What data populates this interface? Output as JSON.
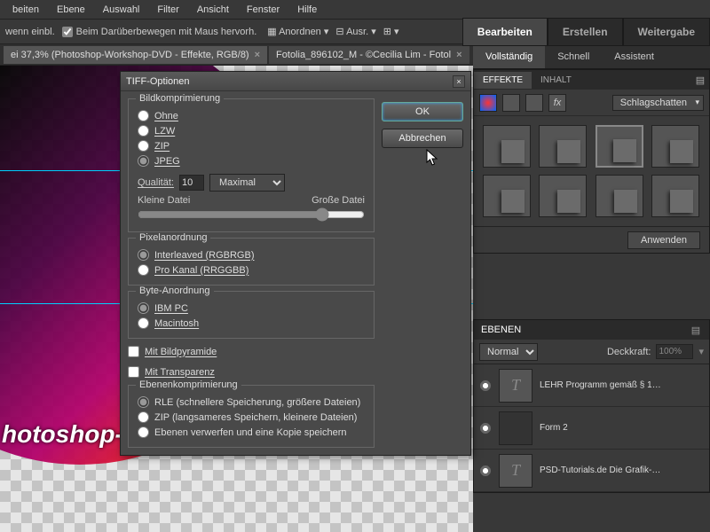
{
  "menu": [
    "beiten",
    "Ebene",
    "Auswahl",
    "Filter",
    "Ansicht",
    "Fenster",
    "Hilfe"
  ],
  "optsbar": {
    "text1": "wenn einbl.",
    "chk1": "Beim Darüberbewegen mit Maus hervorh.",
    "btn1": "Anordnen",
    "btn2": "Ausr.",
    "btn3": ""
  },
  "tabs": [
    "ei 37,3% (Photoshop-Workshop-DVD - Effekte, RGB/8)",
    "Fotolia_896102_M - ©Cecilia Lim - Fotol"
  ],
  "canvas_text": "hotoshop-W",
  "righttabs": [
    "Bearbeiten",
    "Erstellen",
    "Weitergabe"
  ],
  "rightsub": [
    "Vollständig",
    "Schnell",
    "Assistent"
  ],
  "fx": {
    "tabs": [
      "EFFEKTE",
      "INHALT"
    ],
    "drop": "Schlagschatten",
    "apply": "Anwenden"
  },
  "layers": {
    "title": "EBENEN",
    "blend": "Normal",
    "opacity_label": "Deckkraft:",
    "opacity_val": "100%",
    "items": [
      "LEHR Programm gemäß § 1…",
      "Form 2",
      "PSD-Tutorials.de Die Grafik-…"
    ]
  },
  "dialog": {
    "title": "TIFF-Optionen",
    "ok": "OK",
    "cancel": "Abbrechen",
    "g1": {
      "legend": "Bildkomprimierung",
      "opts": [
        "Ohne",
        "LZW",
        "ZIP",
        "JPEG"
      ],
      "quality_label": "Qualität:",
      "quality_val": "10",
      "quality_drop": "Maximal",
      "small": "Kleine Datei",
      "large": "Große Datei"
    },
    "g2": {
      "legend": "Pixelanordnung",
      "opts": [
        "Interleaved (RGBRGB)",
        "Pro Kanal (RRGGBB)"
      ]
    },
    "g3": {
      "legend": "Byte-Anordnung",
      "opts": [
        "IBM PC",
        "Macintosh"
      ]
    },
    "chk1": "Mit Bildpyramide",
    "chk2": "Mit Transparenz",
    "g4": {
      "legend": "Ebenenkomprimierung",
      "opts": [
        "RLE (schnellere Speicherung, größere Dateien)",
        "ZIP (langsameres Speichern, kleinere Dateien)",
        "Ebenen verwerfen und eine Kopie speichern"
      ]
    }
  }
}
